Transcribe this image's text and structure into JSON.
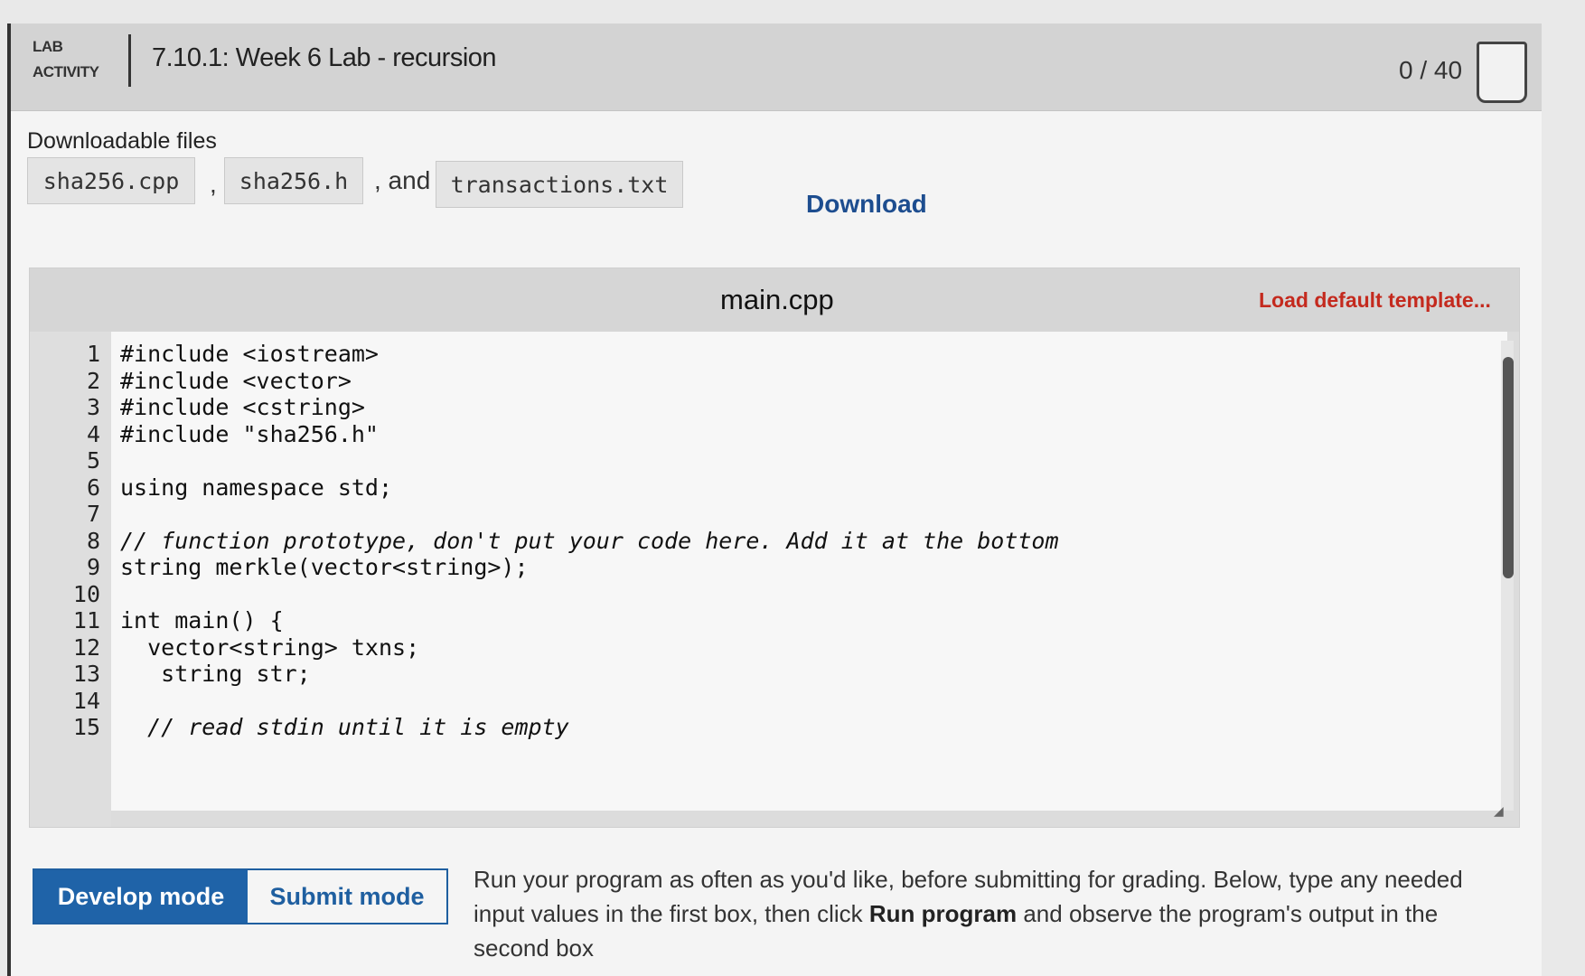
{
  "header": {
    "tag_line1": "LAB",
    "tag_line2": "ACTIVITY",
    "title": "7.10.1: Week 6 Lab - recursion",
    "score": "0 / 40"
  },
  "downloads": {
    "label": "Downloadable files",
    "files": [
      "sha256.cpp",
      "sha256.h",
      "transactions.txt"
    ],
    "separator_comma": ",",
    "separator_and": ", and",
    "download_label": "Download"
  },
  "editor": {
    "filename": "main.cpp",
    "load_default_label": "Load default template...",
    "lines": [
      {
        "num": "1",
        "code": "#include <iostream>"
      },
      {
        "num": "2",
        "code": "#include <vector>"
      },
      {
        "num": "3",
        "code": "#include <cstring>"
      },
      {
        "num": "4",
        "code": "#include \"sha256.h\""
      },
      {
        "num": "5",
        "code": ""
      },
      {
        "num": "6",
        "code": "using namespace std;"
      },
      {
        "num": "7",
        "code": ""
      },
      {
        "num": "8",
        "code": "// function prototype, don't put your code here. Add it at the bottom"
      },
      {
        "num": "9",
        "code": "string merkle(vector<string>);"
      },
      {
        "num": "10",
        "code": ""
      },
      {
        "num": "11",
        "code": "int main() {"
      },
      {
        "num": "12",
        "code": "  vector<string> txns;"
      },
      {
        "num": "13",
        "code": "   string str;"
      },
      {
        "num": "14",
        "code": ""
      },
      {
        "num": "15",
        "code": "  // read stdin until it is empty"
      }
    ]
  },
  "modes": {
    "develop_label": "Develop mode",
    "submit_label": "Submit mode"
  },
  "instructions": {
    "part1": "Run your program as often as you'd like, before submitting for grading. Below, type any needed input values in the first box, then click ",
    "bold": "Run program",
    "part2": " and observe the program's output in the second box"
  }
}
